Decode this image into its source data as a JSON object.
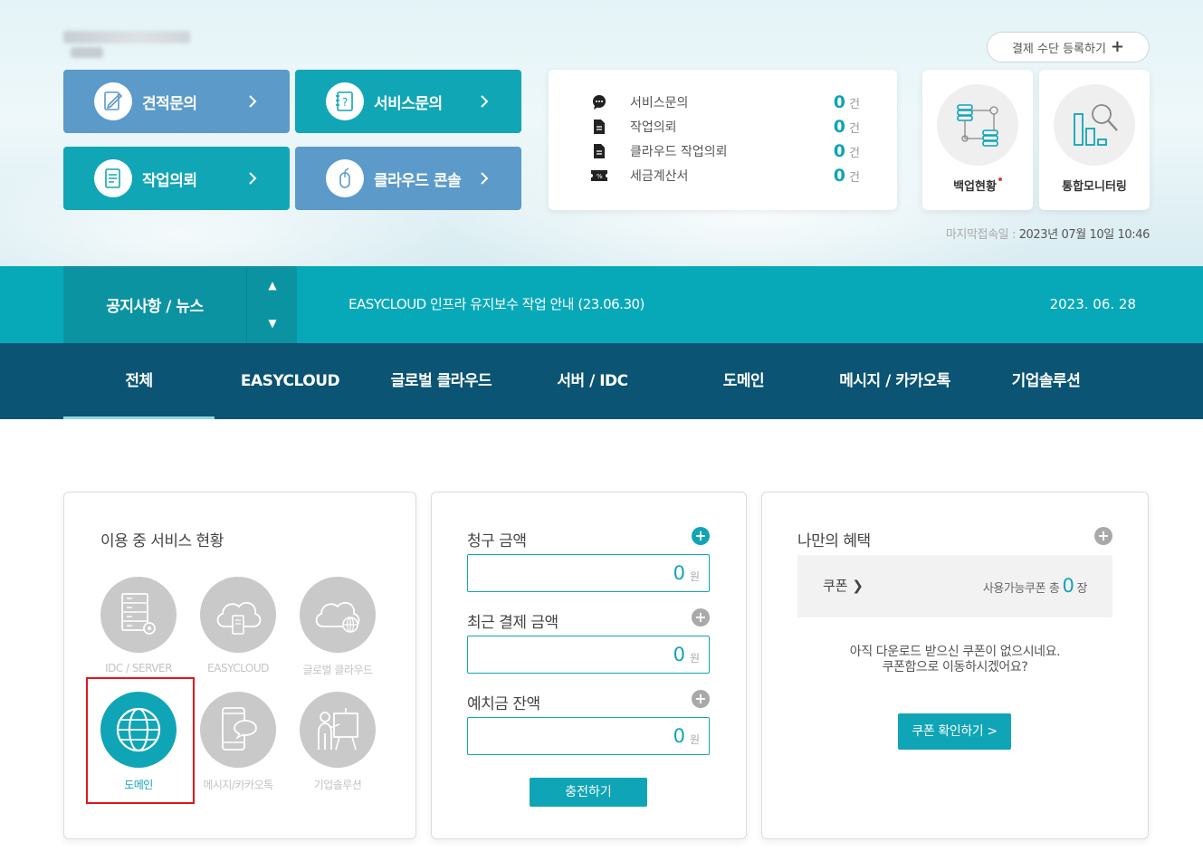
{
  "header": {
    "pay_button_label": "결제 수단 등록하기",
    "last_login_label": "마지막접속일 :",
    "last_login_value": "2023년 07월 10일 10:46"
  },
  "quick_buttons": [
    {
      "label": "견적문의",
      "icon": "quote-document-icon"
    },
    {
      "label": "서비스문의",
      "icon": "question-notebook-icon"
    },
    {
      "label": "작업의뢰",
      "icon": "work-document-icon"
    },
    {
      "label": "클라우드 콘솔",
      "icon": "mouse-icon"
    }
  ],
  "stats": [
    {
      "label": "서비스문의",
      "count": "0",
      "unit": "건",
      "icon": "chat-bubble-icon"
    },
    {
      "label": "작업의뢰",
      "count": "0",
      "unit": "건",
      "icon": "document-icon"
    },
    {
      "label": "클라우드 작업의뢰",
      "count": "0",
      "unit": "건",
      "icon": "document-icon"
    },
    {
      "label": "세금계산서",
      "count": "0",
      "unit": "건",
      "icon": "tax-ticket-icon"
    }
  ],
  "tiles": [
    {
      "label": "백업현황",
      "icon": "backup-server-icon",
      "has_alert": true
    },
    {
      "label": "통합모니터링",
      "icon": "monitoring-chart-icon",
      "has_alert": false
    }
  ],
  "notice": {
    "title": "공지사항 / 뉴스",
    "text": "EASYCLOUD 인프라 유지보수 작업 안내 (23.06.30)",
    "date": "2023. 06. 28"
  },
  "tabs": [
    {
      "label": "전체",
      "active": true
    },
    {
      "label": "EASYCLOUD"
    },
    {
      "label": "글로벌 클라우드"
    },
    {
      "label": "서버 / IDC"
    },
    {
      "label": "도메인"
    },
    {
      "label": "메시지 / 카카오톡"
    },
    {
      "label": "기업솔루션"
    }
  ],
  "services": {
    "title": "이용 중 서비스 현황",
    "items": [
      {
        "label": "IDC / SERVER",
        "icon": "server-gear-icon",
        "active": false
      },
      {
        "label": "EASYCLOUD",
        "icon": "cloud-server-icon",
        "active": false
      },
      {
        "label": "글로벌 클라우드",
        "icon": "cloud-globe-icon",
        "active": false
      },
      {
        "label": "도메인",
        "icon": "globe-icon",
        "active": true
      },
      {
        "label": "메시지/카카오톡",
        "icon": "phone-chat-icon",
        "active": false
      },
      {
        "label": "기업솔루션",
        "icon": "presenter-board-icon",
        "active": false
      }
    ]
  },
  "billing": {
    "items": [
      {
        "label": "청구 금액",
        "amount": "0",
        "unit": "원"
      },
      {
        "label": "최근 결제 금액",
        "amount": "0",
        "unit": "원"
      },
      {
        "label": "예치금 잔액",
        "amount": "0",
        "unit": "원"
      }
    ],
    "charge_button": "충전하기"
  },
  "benefits": {
    "title": "나만의 혜택",
    "coupon_link": "쿠폰",
    "coupon_info_prefix": "사용가능쿠폰 총",
    "coupon_count": "0",
    "coupon_unit": "장",
    "message_line1": "아직 다운로드 받으신 쿠폰이 없으시네요.",
    "message_line2": "쿠폰함으로 이동하시겠어요?",
    "button": "쿠폰 확인하기 >"
  },
  "colors": {
    "teal": "#0fa5b6",
    "blue": "#5b9ac9",
    "navy": "#0b5473",
    "notice_bg": "#07a9b9",
    "highlight": "#e3141a"
  }
}
